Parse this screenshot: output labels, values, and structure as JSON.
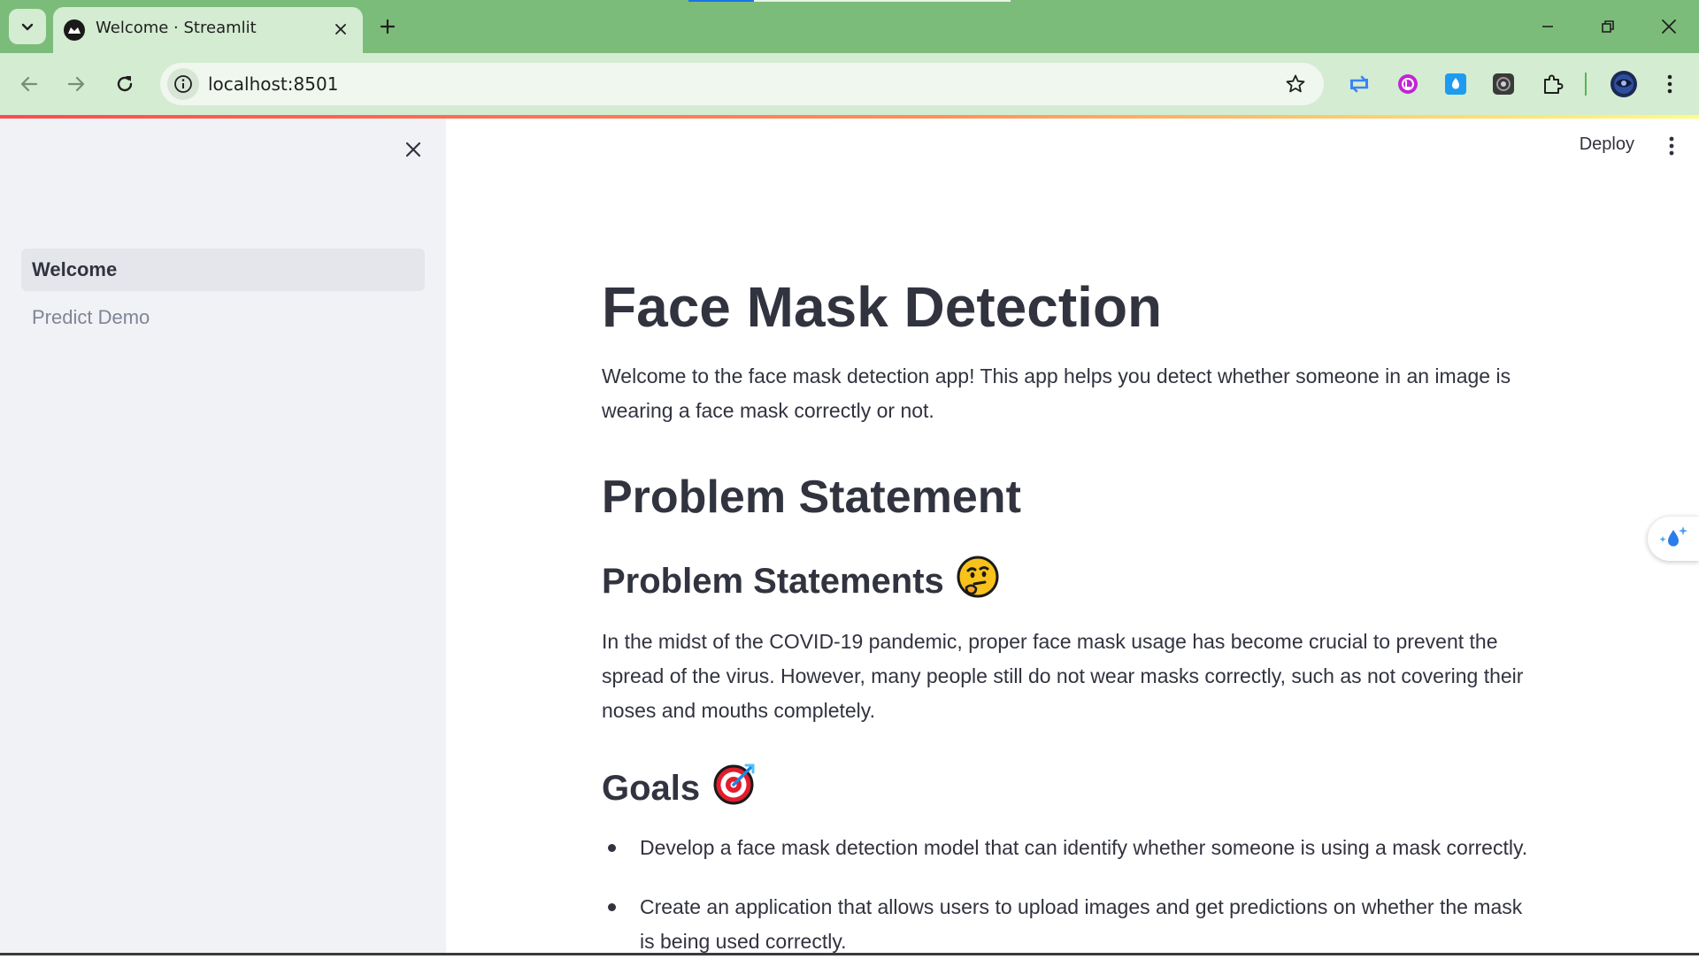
{
  "browser": {
    "tab_title": "Welcome · Streamlit",
    "url": "localhost:8501"
  },
  "sidebar": {
    "items": [
      {
        "label": "Welcome",
        "active": true
      },
      {
        "label": "Predict Demo",
        "active": false
      }
    ]
  },
  "header": {
    "deploy_label": "Deploy"
  },
  "main": {
    "title": "Face Mask Detection",
    "intro": "Welcome to the face mask detection app! This app helps you detect whether someone in an image is wearing a face mask correctly or not.",
    "section_title": "Problem Statement",
    "problem_heading": "Problem Statements",
    "problem_emoji": "🤔",
    "problem_text": "In the midst of the COVID-19 pandemic, proper face mask usage has become crucial to prevent the spread of the virus. However, many people still do not wear masks correctly, such as not covering their noses and mouths completely.",
    "goals_heading": "Goals",
    "goals_emoji": "🎯",
    "goals": [
      "Develop a face mask detection model that can identify whether someone is using a mask correctly.",
      "Create an application that allows users to upload images and get predictions on whether the mask is being used correctly."
    ]
  },
  "colors": {
    "tabstrip": "#7cbc7a",
    "toolbar": "#d4ecd2",
    "sidebar_bg": "#f0f2f6",
    "text": "#31333f",
    "muted": "#808495"
  },
  "icons": [
    "tab-search-icon",
    "streamlit-favicon-icon",
    "close-icon",
    "plus-icon",
    "minimize-icon",
    "restore-icon",
    "back-arrow-icon",
    "forward-arrow-icon",
    "reload-icon",
    "info-icon",
    "star-icon",
    "extension-icon",
    "profile-icon",
    "kebab-menu-icon",
    "water-drop-icon"
  ]
}
